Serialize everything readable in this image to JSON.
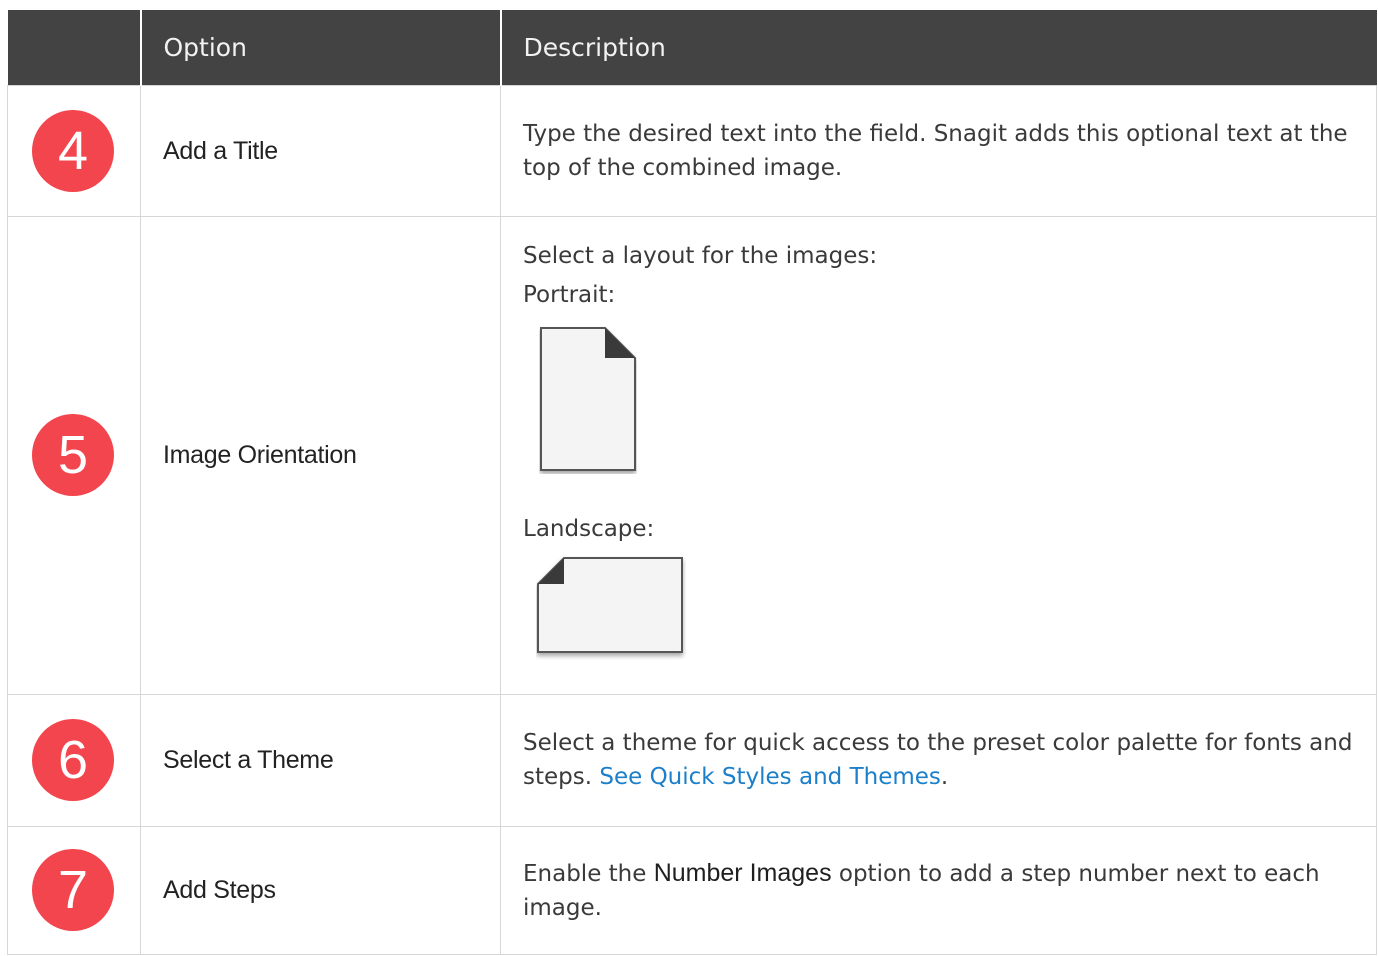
{
  "header": {
    "num_col": "",
    "option_col": "Option",
    "description_col": "Description"
  },
  "rows": [
    {
      "step": "4",
      "option": "Add a Title",
      "description": "Type the desired text into the field. Snagit adds this optional text at the top of the combined image."
    },
    {
      "step": "5",
      "option": "Image Orientation",
      "intro": "Select a layout for the images:",
      "portrait_label": "Portrait:",
      "landscape_label": "Landscape:"
    },
    {
      "step": "6",
      "option": "Select a Theme",
      "description_prefix": "Select a theme for quick access to the preset color palette for fonts and steps. ",
      "link_text": "See Quick Styles and Themes",
      "description_suffix": "."
    },
    {
      "step": "7",
      "option": "Add Steps",
      "description_prefix": "Enable the ",
      "emphasis": "Number Images",
      "description_suffix": " option to add a step number next to each image."
    }
  ],
  "colors": {
    "header_bg": "#434343",
    "badge": "#f2454d",
    "link": "#1b7fc9",
    "border": "#d6d6d6"
  }
}
